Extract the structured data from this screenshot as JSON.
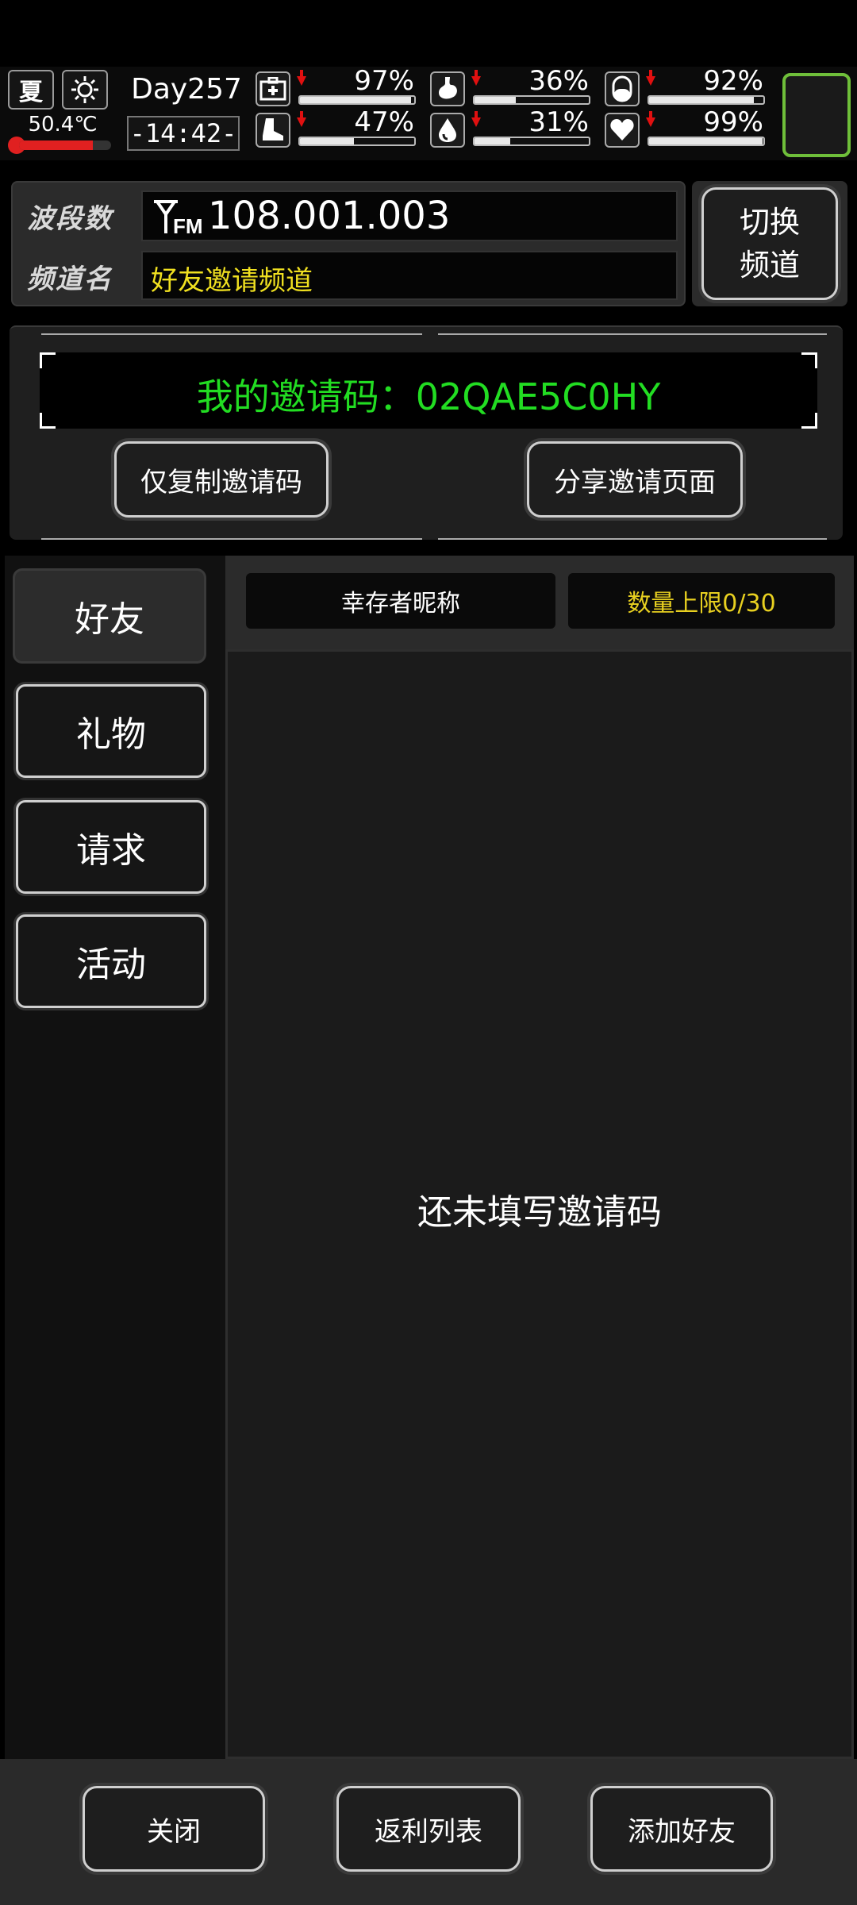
{
  "status": {
    "season": "夏",
    "weather_icon": "sun-icon",
    "temperature": "50.4℃",
    "thermometer_level": 0.8,
    "day": "Day257",
    "time": "-14:42-",
    "stats": [
      {
        "name": "health",
        "icon": "medkit-icon",
        "value": "97%",
        "level": 0.97
      },
      {
        "name": "hunger",
        "icon": "stomach-icon",
        "value": "36%",
        "level": 0.36
      },
      {
        "name": "medicine",
        "icon": "pill-icon",
        "value": "92%",
        "level": 0.92
      },
      {
        "name": "stamina",
        "icon": "boot-icon",
        "value": "47%",
        "level": 0.47
      },
      {
        "name": "thirst",
        "icon": "water-drop-icon",
        "value": "31%",
        "level": 0.31
      },
      {
        "name": "mood",
        "icon": "heart-icon",
        "value": "99%",
        "level": 0.99
      }
    ]
  },
  "radio": {
    "band_label": "波段数",
    "band_icon": "fm-antenna-icon",
    "band_value": "108.001.003",
    "channel_label": "频道名",
    "channel_value": "好友邀请频道",
    "switch_line1": "切换",
    "switch_line2": "频道"
  },
  "invite": {
    "code_text": "我的邀请码：02QAE5C0HY",
    "copy_button": "仅复制邀请码",
    "share_button": "分享邀请页面"
  },
  "tabs": [
    {
      "label": "好友",
      "active": true
    },
    {
      "label": "礼物",
      "active": false
    },
    {
      "label": "请求",
      "active": false
    },
    {
      "label": "活动",
      "active": false
    }
  ],
  "list": {
    "header_name": "幸存者昵称",
    "header_limit": "数量上限0/30",
    "empty_message": "还未填写邀请码"
  },
  "bottom": {
    "close": "关闭",
    "rebate_list": "返利列表",
    "add_friend": "添加好友"
  },
  "colors": {
    "code_green": "#22dd22",
    "channel_yellow": "#f0e020",
    "limit_yellow": "#e8d020",
    "alert_red": "#e01010",
    "slot_green": "#6fbf3a"
  }
}
